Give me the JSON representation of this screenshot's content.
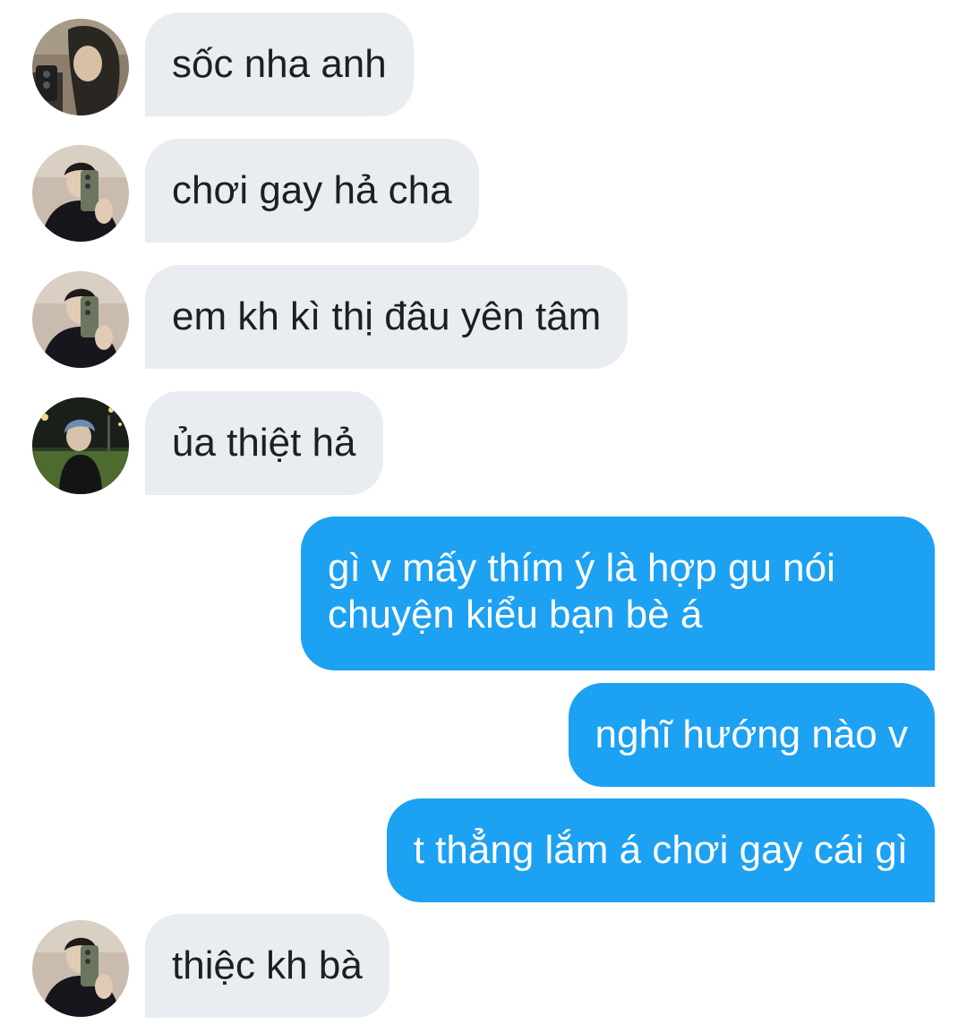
{
  "conversation": {
    "messages": [
      {
        "direction": "incoming",
        "avatar": "avatar-mirror-selfie-long-hair",
        "text": "sốc nha anh"
      },
      {
        "direction": "incoming",
        "avatar": "avatar-mirror-selfie-glasses",
        "text": "chơi gay hả cha"
      },
      {
        "direction": "incoming",
        "avatar": "avatar-mirror-selfie-glasses",
        "text": "em kh kì thị đâu yên tâm"
      },
      {
        "direction": "incoming",
        "avatar": "avatar-night-outdoor-hood",
        "text": "ủa thiệt hả"
      },
      {
        "direction": "outgoing",
        "text": "gì v mấy thím ý là hợp gu nói chuyện kiểu bạn bè á"
      },
      {
        "direction": "outgoing",
        "text": "nghĩ hướng nào v"
      },
      {
        "direction": "outgoing",
        "text": "t thẳng lắm á chơi gay cái gì"
      },
      {
        "direction": "incoming",
        "avatar": "avatar-mirror-selfie-glasses",
        "text": "thiệc kh bà"
      }
    ]
  },
  "colors": {
    "incoming_bubble": "#e9edf1",
    "incoming_text": "#1c1f23",
    "outgoing_bubble": "#1da1f2",
    "outgoing_text": "#ffffff",
    "background": "#ffffff"
  }
}
